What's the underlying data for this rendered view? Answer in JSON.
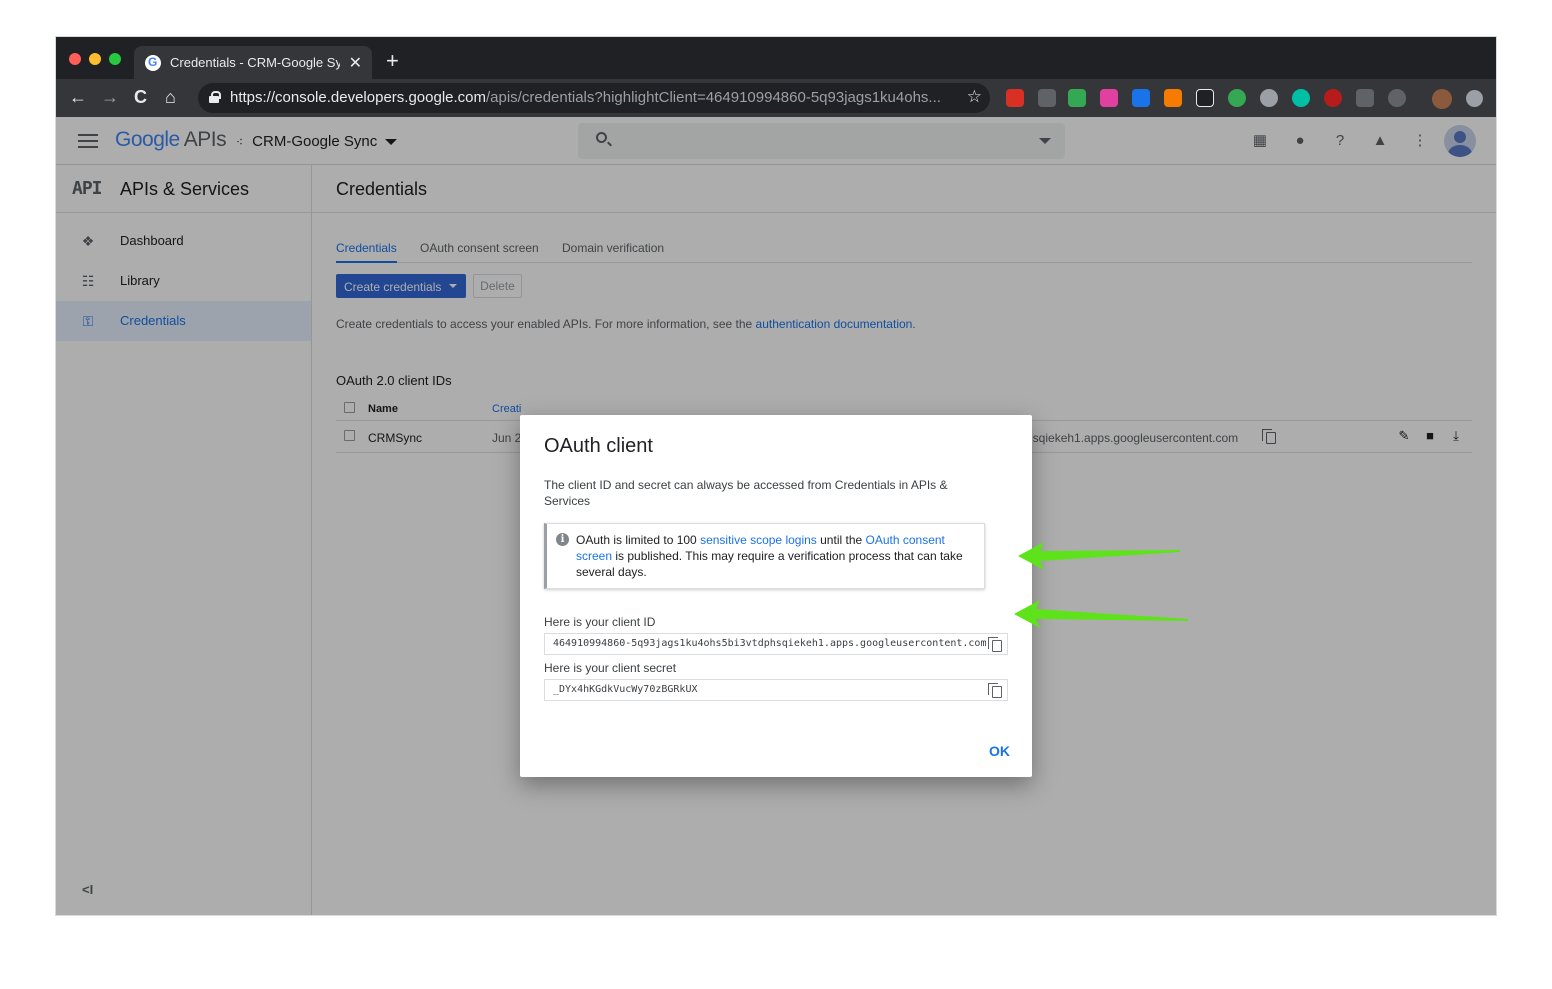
{
  "browser": {
    "tab_title": "Credentials - CRM-Google Sync",
    "tab_close": "✕",
    "new_tab": "+",
    "url_scheme": "https://",
    "url_host": "console.developers.google.com",
    "url_path": "/apis/credentials?highlightClient=464910994860-5q93jags1ku4ohs...",
    "back_icon": "←",
    "forward_icon": "→",
    "reload_icon": "C",
    "home_icon": "⌂",
    "star_icon": "☆"
  },
  "header": {
    "logo_google": "Google",
    "logo_apis": "APIs",
    "project_name": "CRM-Google Sync",
    "project_dots": "⁖"
  },
  "sidebar": {
    "badge": "API",
    "title": "APIs & Services",
    "items": [
      {
        "label": "Dashboard",
        "icon": "❖"
      },
      {
        "label": "Library",
        "icon": "☷"
      },
      {
        "label": "Credentials",
        "icon": "⚿"
      }
    ],
    "collapse": "<I"
  },
  "main": {
    "title": "Credentials",
    "tabs": [
      "Credentials",
      "OAuth consent screen",
      "Domain verification"
    ],
    "create_button": "Create credentials",
    "delete_button": "Delete",
    "info_text": "Create credentials to access your enabled APIs. For more information, see the ",
    "info_link": "authentication documentation",
    "info_end": ".",
    "section_title": "OAuth 2.0 client IDs",
    "table": {
      "columns": [
        "Name",
        "Creati"
      ],
      "rows": [
        {
          "name": "CRMSync",
          "created": "Jun 2",
          "client_id": "nsqiekeh1.apps.googleusercontent.com"
        }
      ]
    }
  },
  "dialog": {
    "title": "OAuth client",
    "description": "The client ID and secret can always be accessed from Credentials in APIs & Services",
    "notice_pre": "OAuth is limited to 100 ",
    "notice_link1": "sensitive scope logins",
    "notice_mid": " until the ",
    "notice_link2": "OAuth consent screen",
    "notice_post": " is published. This may require a verification process that can take several days.",
    "client_id_label": "Here is your client ID",
    "client_id": "464910994860-5q93jags1ku4ohs5bi3vtdphsqiekeh1.apps.googleusercontent.com",
    "client_secret_label": "Here is your client secret",
    "client_secret": "_DYx4hKGdkVucWy70zBGRkUX",
    "ok": "OK"
  },
  "colors": {
    "accent": "#1a73e8",
    "annotation_arrow": "#5ee31a"
  }
}
